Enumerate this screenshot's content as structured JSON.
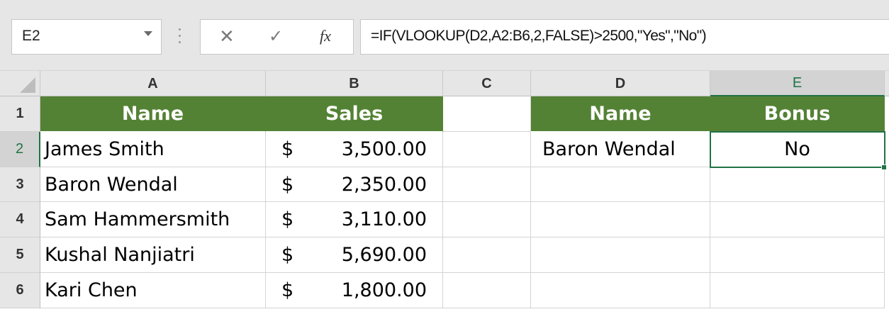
{
  "name_box": {
    "value": "E2"
  },
  "formula_bar": {
    "formula": "=IF(VLOOKUP(D2,A2:B6,2,FALSE)>2500,\"Yes\",\"No\")",
    "cancel_glyph": "✕",
    "enter_glyph": "✓",
    "function_glyph": "fx"
  },
  "columns": [
    "A",
    "B",
    "C",
    "D",
    "E"
  ],
  "rows": [
    "1",
    "2",
    "3",
    "4",
    "5",
    "6"
  ],
  "table": {
    "header_name": "Name",
    "header_sales": "Sales",
    "rows": [
      {
        "name": "James Smith",
        "currency": "$",
        "amount": "3,500.00"
      },
      {
        "name": "Baron Wendal",
        "currency": "$",
        "amount": "2,350.00"
      },
      {
        "name": "Sam Hammersmith",
        "currency": "$",
        "amount": "3,110.00"
      },
      {
        "name": "Kushal Nanjiatri",
        "currency": "$",
        "amount": "5,690.00"
      },
      {
        "name": "Kari Chen",
        "currency": "$",
        "amount": "1,800.00"
      }
    ]
  },
  "lookup": {
    "header_name": "Name",
    "header_bonus": "Bonus",
    "name_value": "Baron Wendal",
    "bonus_value": "No"
  },
  "colors": {
    "header_green": "#548235",
    "selection_green": "#217346",
    "chrome_gray": "#e6e6e6"
  }
}
